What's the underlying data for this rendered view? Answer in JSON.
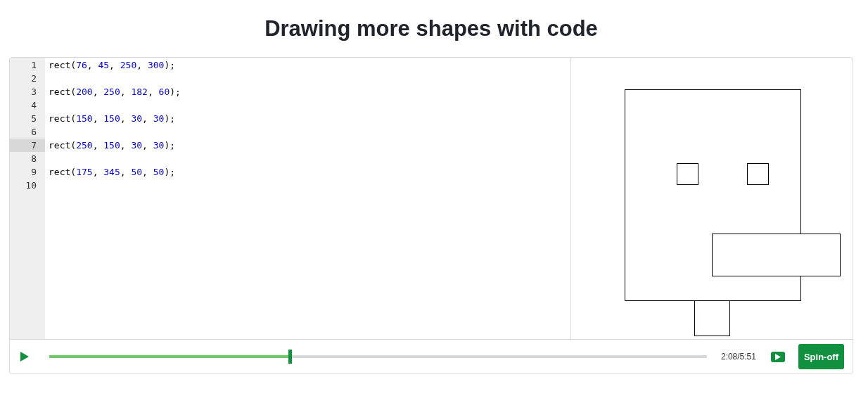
{
  "title": "Drawing more shapes with code",
  "editor": {
    "lines": [
      {
        "number": "1",
        "selected": false,
        "tokens": [
          {
            "kind": "plain",
            "text": "rect("
          },
          {
            "kind": "number",
            "text": "76"
          },
          {
            "kind": "plain",
            "text": ", "
          },
          {
            "kind": "number",
            "text": "45"
          },
          {
            "kind": "plain",
            "text": ", "
          },
          {
            "kind": "number",
            "text": "250"
          },
          {
            "kind": "plain",
            "text": ", "
          },
          {
            "kind": "number",
            "text": "300"
          },
          {
            "kind": "plain",
            "text": ");"
          }
        ]
      },
      {
        "number": "2",
        "selected": false
      },
      {
        "number": "3",
        "selected": false,
        "tokens": [
          {
            "kind": "plain",
            "text": "rect("
          },
          {
            "kind": "number",
            "text": "200"
          },
          {
            "kind": "plain",
            "text": ", "
          },
          {
            "kind": "number",
            "text": "250"
          },
          {
            "kind": "plain",
            "text": ", "
          },
          {
            "kind": "number",
            "text": "182"
          },
          {
            "kind": "plain",
            "text": ", "
          },
          {
            "kind": "number",
            "text": "60"
          },
          {
            "kind": "plain",
            "text": ");"
          }
        ]
      },
      {
        "number": "4",
        "selected": false
      },
      {
        "number": "5",
        "selected": false,
        "tokens": [
          {
            "kind": "plain",
            "text": "rect("
          },
          {
            "kind": "number",
            "text": "150"
          },
          {
            "kind": "plain",
            "text": ", "
          },
          {
            "kind": "number",
            "text": "150"
          },
          {
            "kind": "plain",
            "text": ", "
          },
          {
            "kind": "number",
            "text": "30"
          },
          {
            "kind": "plain",
            "text": ", "
          },
          {
            "kind": "number",
            "text": "30"
          },
          {
            "kind": "plain",
            "text": ");"
          }
        ]
      },
      {
        "number": "6",
        "selected": false
      },
      {
        "number": "7",
        "selected": true,
        "tokens": [
          {
            "kind": "plain",
            "text": "rect("
          },
          {
            "kind": "number",
            "text": "250"
          },
          {
            "kind": "plain",
            "text": ", "
          },
          {
            "kind": "number",
            "text": "150"
          },
          {
            "kind": "plain",
            "text": ", "
          },
          {
            "kind": "number",
            "text": "30"
          },
          {
            "kind": "plain",
            "text": ", "
          },
          {
            "kind": "number",
            "text": "30"
          },
          {
            "kind": "plain",
            "text": ");"
          }
        ]
      },
      {
        "number": "8",
        "selected": false
      },
      {
        "number": "9",
        "selected": false,
        "tokens": [
          {
            "kind": "plain",
            "text": "rect("
          },
          {
            "kind": "number",
            "text": "175"
          },
          {
            "kind": "plain",
            "text": ", "
          },
          {
            "kind": "number",
            "text": "345"
          },
          {
            "kind": "plain",
            "text": ", "
          },
          {
            "kind": "number",
            "text": "50"
          },
          {
            "kind": "plain",
            "text": ", "
          },
          {
            "kind": "number",
            "text": "50"
          },
          {
            "kind": "plain",
            "text": ");"
          }
        ]
      },
      {
        "number": "10",
        "selected": false
      }
    ]
  },
  "player": {
    "level": 0.366,
    "time": "2:08/5:51",
    "spin_off": "Spin-off"
  }
}
